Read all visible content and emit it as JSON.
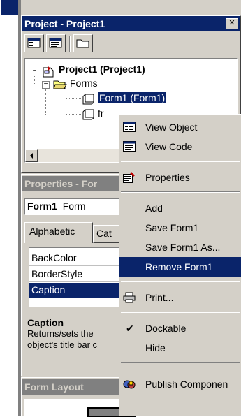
{
  "project_window": {
    "title": "Project - Project1",
    "close_glyph": "✕",
    "tree": {
      "root_label": "Project1 (Project1)",
      "folder_label": "Forms",
      "item1_label": "Form1 (Form1)",
      "item2_label": "fr"
    }
  },
  "properties_window": {
    "title": "Properties - For",
    "object_name": "Form1",
    "object_type": "Form",
    "tabs": [
      "Alphabetic",
      "Cat"
    ],
    "rows": [
      "BackColor",
      "BorderStyle",
      "Caption"
    ],
    "desc_title": "Caption",
    "desc_text_1": "Returns/sets the",
    "desc_text_2": "object's title bar c"
  },
  "form_layout_window": {
    "title": "Form Layout"
  },
  "context_menu": {
    "items": [
      {
        "label": "View Object",
        "icon": "view-object-icon"
      },
      {
        "label": "View Code",
        "icon": "view-code-icon"
      },
      {
        "label": "Properties",
        "icon": "properties-icon"
      },
      {
        "label": "Add"
      },
      {
        "label": "Save Form1"
      },
      {
        "label": "Save Form1 As..."
      },
      {
        "label": "Remove Form1",
        "selected": true
      },
      {
        "label": "Print...",
        "icon": "printer-icon"
      },
      {
        "label": "Dockable",
        "checked": true
      },
      {
        "label": "Hide"
      },
      {
        "label": "Publish Componen",
        "icon": "publish-icon"
      }
    ]
  },
  "colors": {
    "titlebar_active": "#0a246a",
    "titlebar_inactive": "#808080",
    "face": "#d4d0c8",
    "selection": "#0a246a"
  }
}
